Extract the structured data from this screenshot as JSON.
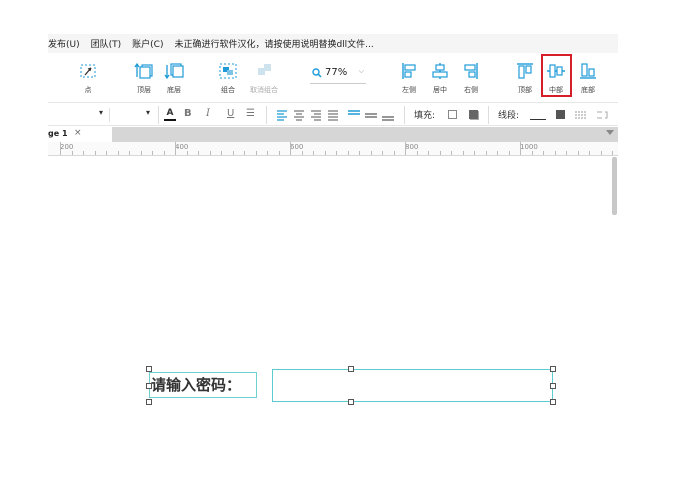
{
  "menu": {
    "items": [
      "发布(U)",
      "团队(T)",
      "账户(C)"
    ],
    "notice": "未正确进行软件汉化，请按使用说明替换dll文件..."
  },
  "toolbar": {
    "point_label": "点",
    "front_label": "顶层",
    "back_label": "底层",
    "group_label": "组合",
    "ungroup_label": "取消组合",
    "zoom_value": "77%",
    "align_left_label": "左侧",
    "align_center_label": "居中",
    "align_right_label": "右侧",
    "align_top_label": "顶部",
    "align_middle_label": "中部",
    "align_bottom_label": "底部"
  },
  "formatbar": {
    "fill_label": "填充:",
    "line_label": "线段:"
  },
  "tabs": [
    {
      "label": "ge 1",
      "close": "×"
    }
  ],
  "ruler": {
    "labels": [
      "200",
      "400",
      "600",
      "800",
      "1000"
    ]
  },
  "canvas": {
    "label_text": "请输入密码：",
    "input_value": ""
  },
  "colors": {
    "accent": "#1e9bd7",
    "selection": "#5ccbcd",
    "highlight": "#d61e2a"
  }
}
